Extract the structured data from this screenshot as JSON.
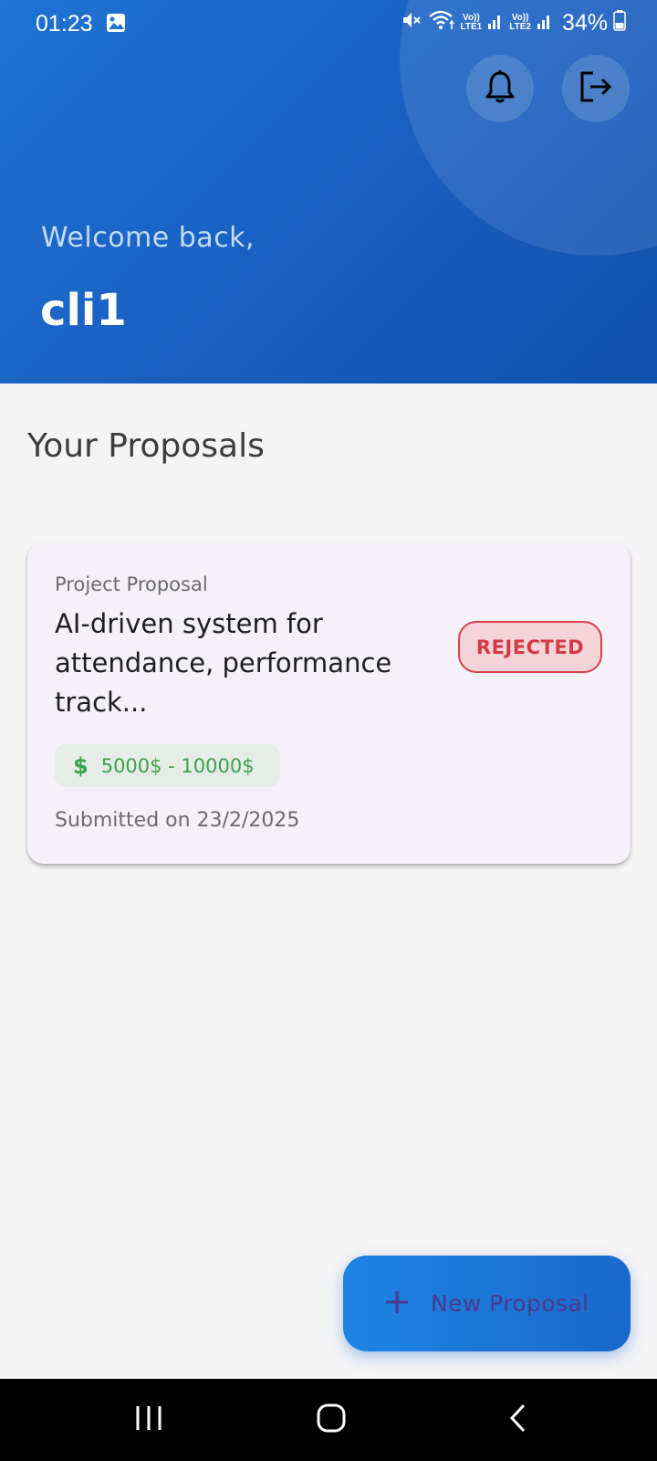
{
  "status_bar": {
    "time": "01:23",
    "battery": "34%",
    "sim1": "LTE1",
    "sim2": "LTE2",
    "volte": "Vo))"
  },
  "header": {
    "welcome": "Welcome back,",
    "username": "cli1",
    "icons": [
      "bell-icon",
      "logout-icon"
    ]
  },
  "section_title": "Your Proposals",
  "proposals": [
    {
      "type": "Project Proposal",
      "title": "AI-driven system for attendance, performance track...",
      "status": "REJECTED",
      "budget": "5000$ - 10000$",
      "budget_icon": "$",
      "submitted": "Submitted on 23/2/2025"
    }
  ],
  "fab": {
    "label": "New Proposal",
    "icon": "plus-icon"
  },
  "colors": {
    "header_start": "#1f73d3",
    "header_end": "#1150ab",
    "rejected": "#d33a44",
    "budget": "#3aa54a",
    "background": "#f4f4f5"
  },
  "navbar": {
    "icons": [
      "recents-icon",
      "home-icon",
      "back-icon"
    ]
  }
}
